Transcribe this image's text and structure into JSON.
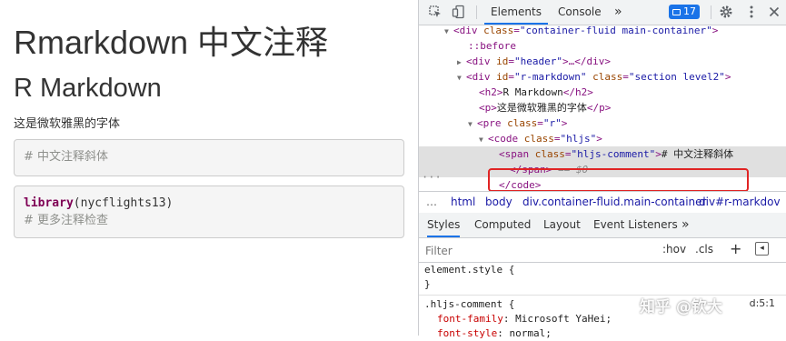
{
  "page": {
    "h1": "Rmarkdown 中文注释",
    "h2": "R Markdown",
    "paragraph": "这是微软雅黑的字体",
    "code1": {
      "comment": "# 中文注释斜体"
    },
    "code2": {
      "keyword": "library",
      "args": "(nycflights13)",
      "comment": "# 更多注释检查"
    }
  },
  "devtools": {
    "tabs": {
      "elements": "Elements",
      "console": "Console",
      "more": "»"
    },
    "badge_count": "17",
    "dom": {
      "l1": {
        "tag": "div",
        "attr": "class",
        "val": "\"container-fluid main-container\""
      },
      "l2": "::before",
      "l3": {
        "tag": "div",
        "attr": "id",
        "val": "\"header\"",
        "tail": "…</div>"
      },
      "l4": {
        "tag": "div",
        "attr1": "id",
        "val1": "\"r-markdown\"",
        "attr2": "class",
        "val2": "\"section level2\""
      },
      "l5": {
        "open": "<h2>",
        "text": "R Markdown",
        "close": "</h2>"
      },
      "l6": {
        "open": "<p>",
        "text": "这是微软雅黑的字体",
        "close": "</p>"
      },
      "l7": {
        "tag": "pre",
        "attr": "class",
        "val": "\"r\""
      },
      "l8": {
        "tag": "code",
        "attr": "class",
        "val": "\"hljs\""
      },
      "l9": {
        "tag": "span",
        "attr": "class",
        "val": "\"hljs-comment\"",
        "text": "# 中文注释斜体"
      },
      "l10": {
        "close": "</span>",
        "eq": "== $0"
      },
      "l11": "</code>"
    },
    "breadcrumbs": [
      "…",
      "html",
      "body",
      "div.container-fluid.main-container",
      "div#r-markdov"
    ],
    "styles_tabs": {
      "styles": "Styles",
      "computed": "Computed",
      "layout": "Layout",
      "listeners": "Event Listeners",
      "more": "»"
    },
    "filter": {
      "placeholder": "Filter",
      "hov": ":hov",
      "cls": ".cls",
      "add": "+"
    },
    "rules": {
      "element_style": "element.style {",
      "close_brace": "}",
      "selector": ".hljs-comment {",
      "p1_name": "font-family",
      "p1_value": "Microsoft YaHei;",
      "p2_name": "font-style",
      "p2_value": "normal;",
      "source": "d:5:1"
    },
    "watermark": "知乎 @钦大"
  }
}
